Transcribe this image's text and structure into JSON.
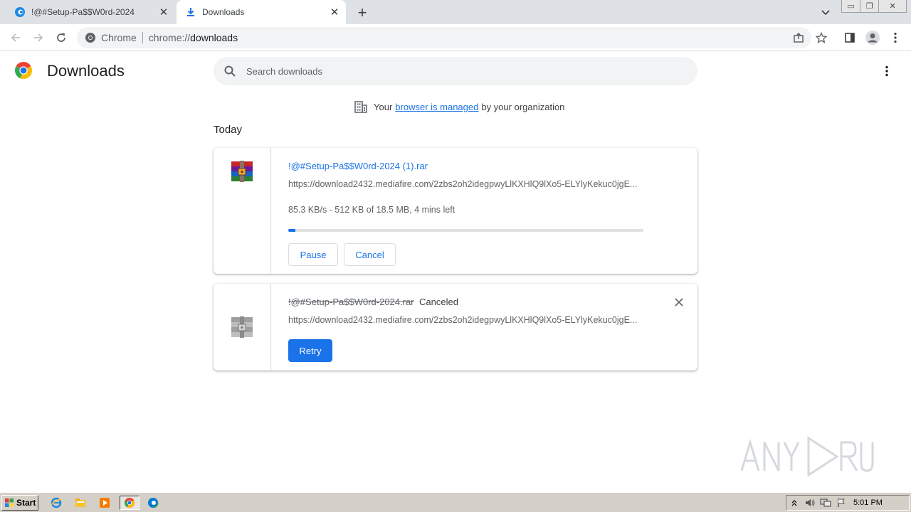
{
  "browser": {
    "tabs": [
      {
        "title": "!@#Setup-Pa$$W0rd-2024",
        "icon": "edge-icon",
        "active": false
      },
      {
        "title": "Downloads",
        "icon": "download-icon",
        "active": true
      }
    ],
    "site_chip": "Chrome",
    "url_scheme": "chrome://",
    "url_host": "downloads"
  },
  "page": {
    "title": "Downloads",
    "search_placeholder": "Search downloads",
    "managed_prefix": "Your",
    "managed_link": "browser is managed",
    "managed_suffix": "by your organization",
    "section": "Today"
  },
  "downloads": [
    {
      "filename": "!@#Setup-Pa$$W0rd-2024 (1).rar",
      "url": "https://download2432.mediafire.com/2zbs2oh2idegpwyLlKXHlQ9lXo5-ELYlyKekuc0jgE...",
      "progress_text": "85.3 KB/s - 512 KB of 18.5 MB, 4 mins left",
      "progress_fraction": 0.02,
      "pause_label": "Pause",
      "cancel_label": "Cancel"
    },
    {
      "filename": "!@#Setup-Pa$$W0rd-2024.rar",
      "status": "Canceled",
      "url": "https://download2432.mediafire.com/2zbs2oh2idegpwyLlKXHlQ9lXo5-ELYlyKekuc0jgE...",
      "retry_label": "Retry"
    }
  ],
  "taskbar": {
    "start_label": "Start",
    "clock": "5:01 PM"
  },
  "colors": {
    "accent": "#1a73e8",
    "tabstrip": "#dee1e6",
    "taskbar": "#d4d0c8"
  }
}
